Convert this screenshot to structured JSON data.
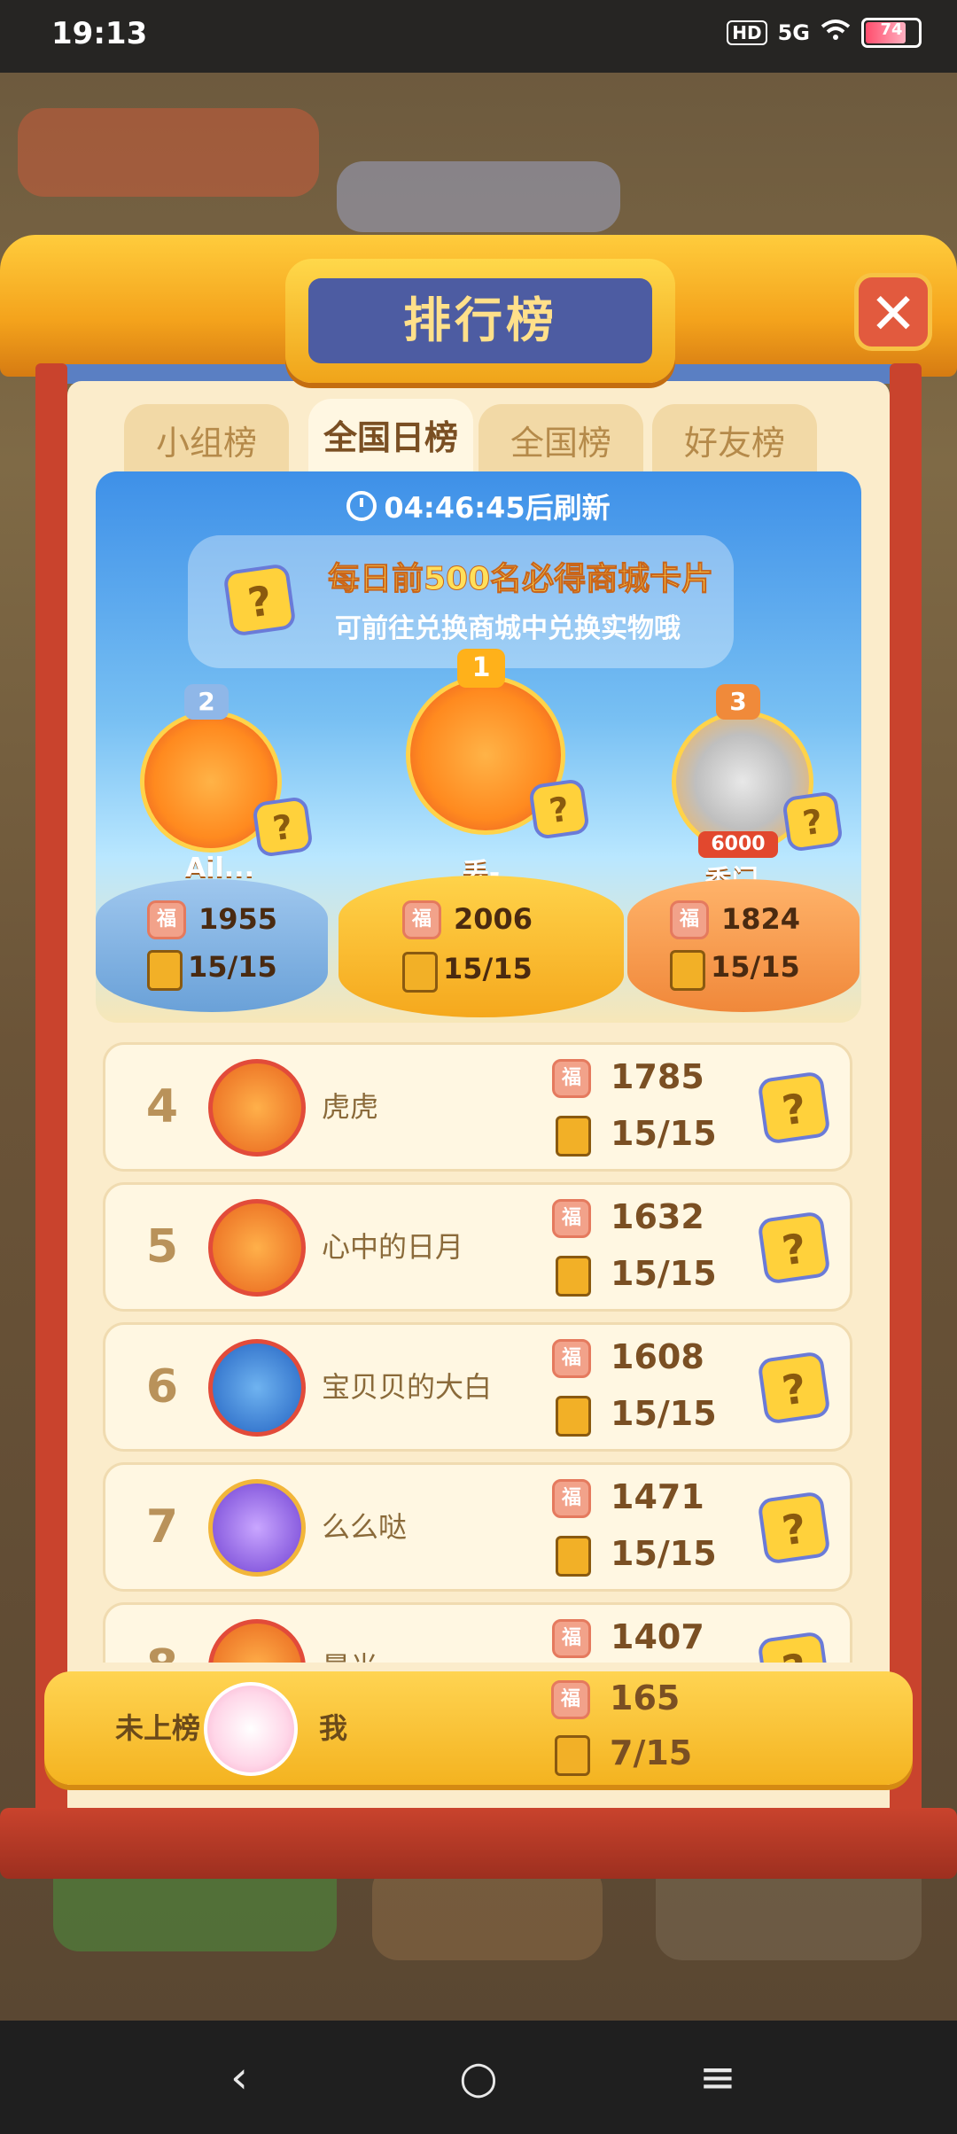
{
  "status_bar": {
    "time": "19:13",
    "hd": "HD",
    "network": "5G",
    "battery": "74"
  },
  "panel": {
    "title": "排行榜",
    "close_label": "✕",
    "tabs": [
      {
        "label": "小组榜",
        "active": false
      },
      {
        "label": "全国日榜",
        "active": true
      },
      {
        "label": "全国榜",
        "active": false
      },
      {
        "label": "好友榜",
        "active": false
      }
    ],
    "refresh_text": "04:46:45后刷新",
    "notice_line1": "每日前500名必得商城卡片",
    "notice_line2": "可前往兑换商城中兑换实物哦",
    "card_symbol": "?",
    "fu_symbol": "福"
  },
  "podium": [
    {
      "rank": "2",
      "name": "Ail...",
      "score": "1955",
      "progress": "15/15"
    },
    {
      "rank": "1",
      "name": "丢-",
      "score": "2006",
      "progress": "15/15"
    },
    {
      "rank": "3",
      "name": "香门 ...",
      "score": "1824",
      "progress": "15/15",
      "badge": "6000"
    }
  ],
  "list": [
    {
      "rank": "4",
      "name": "虎虎",
      "score": "1785",
      "progress": "15/15"
    },
    {
      "rank": "5",
      "name": "心中的日月",
      "score": "1632",
      "progress": "15/15"
    },
    {
      "rank": "6",
      "name": "宝贝贝的大白",
      "score": "1608",
      "progress": "15/15"
    },
    {
      "rank": "7",
      "name": "么么哒",
      "score": "1471",
      "progress": "15/15"
    },
    {
      "rank": "8",
      "name": "晨光",
      "score": "1407",
      "progress": ""
    }
  ],
  "me": {
    "rank": "未上榜",
    "name": "我",
    "score": "165",
    "progress": "7/15"
  },
  "navbar": {
    "back": "‹",
    "home": "○",
    "menu": "≡"
  }
}
